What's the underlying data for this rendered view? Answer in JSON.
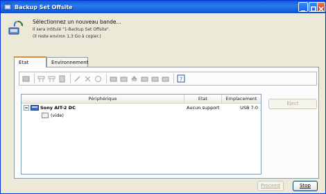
{
  "window": {
    "title": "Backup Set Offsite"
  },
  "header": {
    "title": "Sélectionnez un nouveau bande...",
    "line1": "Il sera intitulé \"1-Backup Set Offsite\".",
    "line2": "(Il reste environ 1,3 Go à copier.)"
  },
  "tabs": [
    {
      "label": "Etat"
    },
    {
      "label": "Environnement"
    }
  ],
  "list": {
    "columns": [
      "Périphérique",
      "Etat",
      "Emplacement"
    ],
    "rows": [
      {
        "device": "Sony AIT-2 DC",
        "state": "Aucun support",
        "location": "USB 7:0"
      },
      {
        "device": "(vide)",
        "state": "",
        "location": ""
      }
    ]
  },
  "buttons": {
    "eject": "Eject",
    "proceed": "Proceed",
    "stop": "Stop"
  },
  "colors": {
    "titlebar": "#0a5fd8",
    "face": "#ece9d8",
    "close": "#c23a1a"
  }
}
